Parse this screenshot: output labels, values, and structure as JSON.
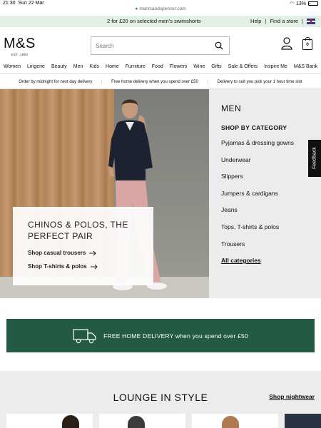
{
  "status_bar": {
    "time": "21:30",
    "date": "Sun 22 Mar",
    "url": "marksandspencer.com",
    "battery": "13%"
  },
  "promo_bar": {
    "message": "2 for £20 on selected men's swimshorts",
    "help": "Help",
    "find_store": "Find a store"
  },
  "header": {
    "logo": "M&S",
    "logo_sub": "EST. 1884",
    "search_placeholder": "Search",
    "basket_count": "0"
  },
  "nav": [
    "Women",
    "Lingerie",
    "Beauty",
    "Men",
    "Kids",
    "Home",
    "Furniture",
    "Food",
    "Flowers",
    "Wine",
    "Gifts",
    "Sale & Offers",
    "Inspire Me",
    "M&S Bank"
  ],
  "delivery_bar": [
    "Order by midnight for next day delivery",
    "Free home delivery when you spend over £50",
    "Delivery to suit you pick your 1 hour time slot"
  ],
  "hero": {
    "title": "CHINOS & POLOS, THE PERFECT PAIR",
    "link1": "Shop casual trousers",
    "link2": "Shop T-shirts & polos"
  },
  "category_panel": {
    "heading": "MEN",
    "subheading": "SHOP BY CATEGORY",
    "items": [
      "Pyjamas & dressing gowns",
      "Underwear",
      "Slippers",
      "Jumpers & cardigans",
      "Jeans",
      "Tops, T-shirts & polos",
      "Trousers"
    ],
    "all_link": "All categories"
  },
  "feedback_tab": "Feedback",
  "banner": {
    "text": "FREE HOME DELIVERY when you spend over £50",
    "color": "#235a44"
  },
  "lounge": {
    "title": "LOUNGE IN STYLE",
    "link": "Shop nightwear"
  }
}
